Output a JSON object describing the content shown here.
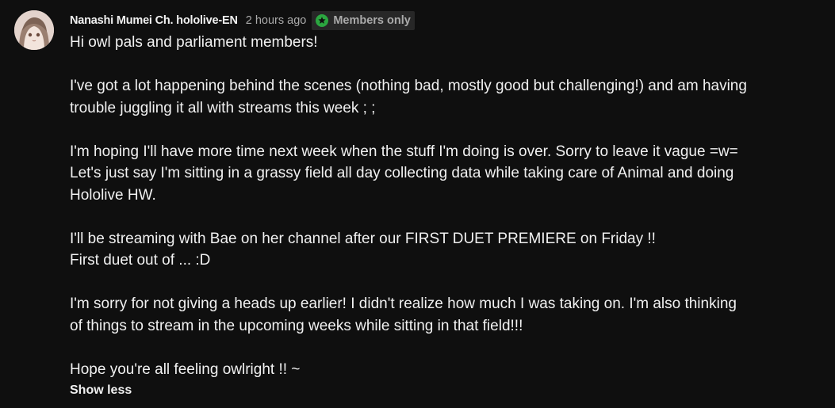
{
  "post": {
    "author": "Nanashi Mumei Ch. hololive-EN",
    "time": "2 hours ago",
    "badge": {
      "label": "Members only",
      "icon": "star-icon",
      "color": "#2ba640"
    },
    "lines": [
      "Hi owl pals and parliament members!",
      "",
      "I've got a lot happening behind the scenes (nothing bad, mostly good but challenging!) and am having",
      "trouble juggling it all with streams this week ; ;",
      "",
      "I'm hoping I'll have more time next week when the stuff I'm doing is over. Sorry to leave it vague =w=",
      "Let's just say I'm sitting in a grassy field all day collecting data while taking care of Animal and doing",
      "Hololive HW.",
      "",
      "I'll be streaming with Bae on her channel after our FIRST DUET PREMIERE on Friday !!",
      "First duet out of ... :D",
      "",
      "I'm sorry for not giving a heads up earlier! I didn't realize how much I was taking on. I'm also thinking",
      "of things to stream in the upcoming weeks while sitting in that field!!!",
      "",
      "Hope you're all feeling owlright !! ~"
    ],
    "show_less_label": "Show less"
  },
  "colors": {
    "background": "#0f0f0f",
    "text": "#f1f1f1",
    "secondary_text": "#aaaaaa",
    "badge_background": "#272727"
  }
}
